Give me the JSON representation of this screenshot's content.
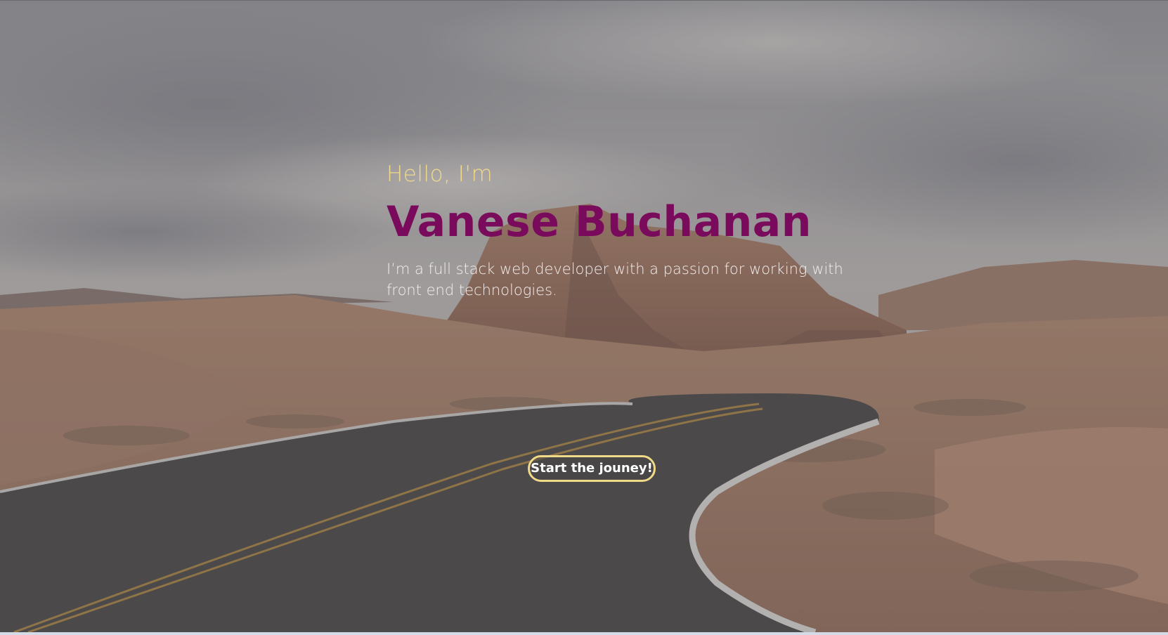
{
  "hero": {
    "greeting": "Hello, I'm",
    "name": "Vanese Buchanan",
    "tagline": "I’m a full stack web developer with a passion for working with front end technologies.",
    "cta_label": "Start the jouney!",
    "background": "desert-road-photo"
  },
  "colors": {
    "greeting": "#f1d98a",
    "name": "#7a0a5c",
    "tagline": "#f3eeee",
    "cta_border": "#f1d98a",
    "cta_text": "#ffffff"
  }
}
